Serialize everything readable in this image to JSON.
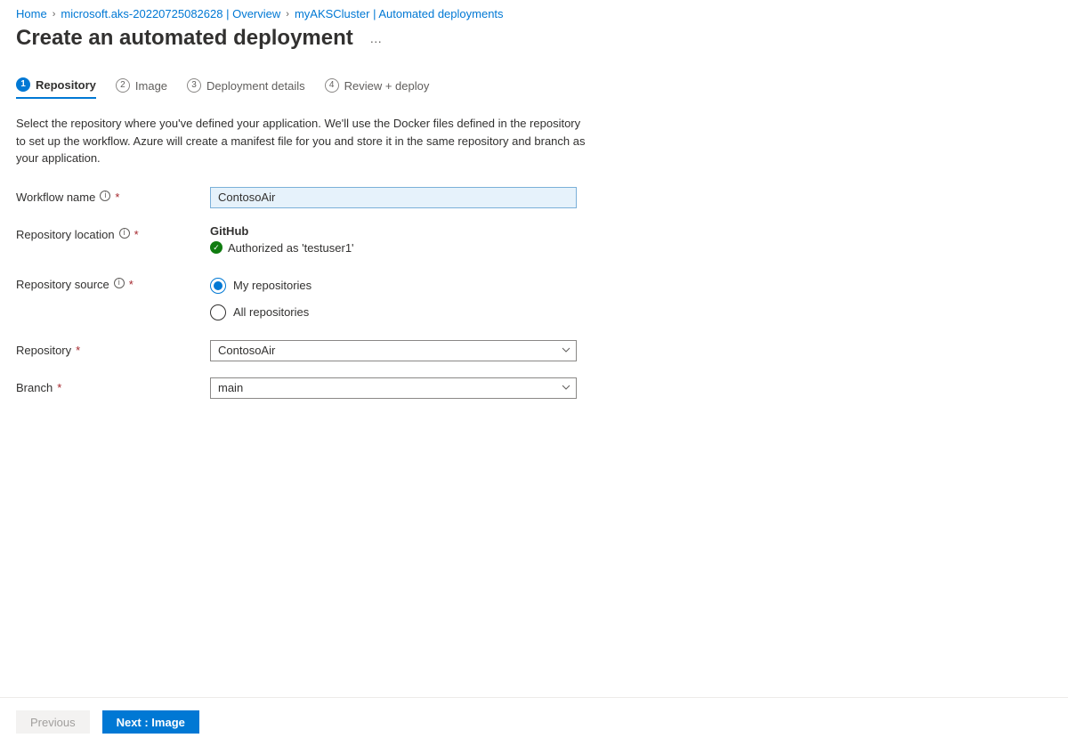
{
  "breadcrumb": {
    "items": [
      {
        "label": "Home"
      },
      {
        "label": "microsoft.aks-20220725082628 | Overview"
      },
      {
        "label": "myAKSCluster | Automated deployments"
      }
    ]
  },
  "page": {
    "title": "Create an automated deployment"
  },
  "tabs": [
    {
      "num": "1",
      "label": "Repository",
      "active": true
    },
    {
      "num": "2",
      "label": "Image",
      "active": false
    },
    {
      "num": "3",
      "label": "Deployment details",
      "active": false
    },
    {
      "num": "4",
      "label": "Review + deploy",
      "active": false
    }
  ],
  "intro": "Select the repository where you've defined your application. We'll use the Docker files defined in the repository to set up the workflow. Azure will create a manifest file for you and store it in the same repository and branch as your application.",
  "form": {
    "workflow_name": {
      "label": "Workflow name",
      "value": "ContosoAir"
    },
    "repo_location": {
      "label": "Repository location",
      "provider": "GitHub",
      "authorized_as": "Authorized as 'testuser1'"
    },
    "repo_source": {
      "label": "Repository source",
      "options": [
        {
          "label": "My repositories",
          "selected": true
        },
        {
          "label": "All repositories",
          "selected": false
        }
      ]
    },
    "repository": {
      "label": "Repository",
      "value": "ContosoAir"
    },
    "branch": {
      "label": "Branch",
      "value": "main"
    }
  },
  "footer": {
    "previous": "Previous",
    "next": "Next : Image"
  }
}
